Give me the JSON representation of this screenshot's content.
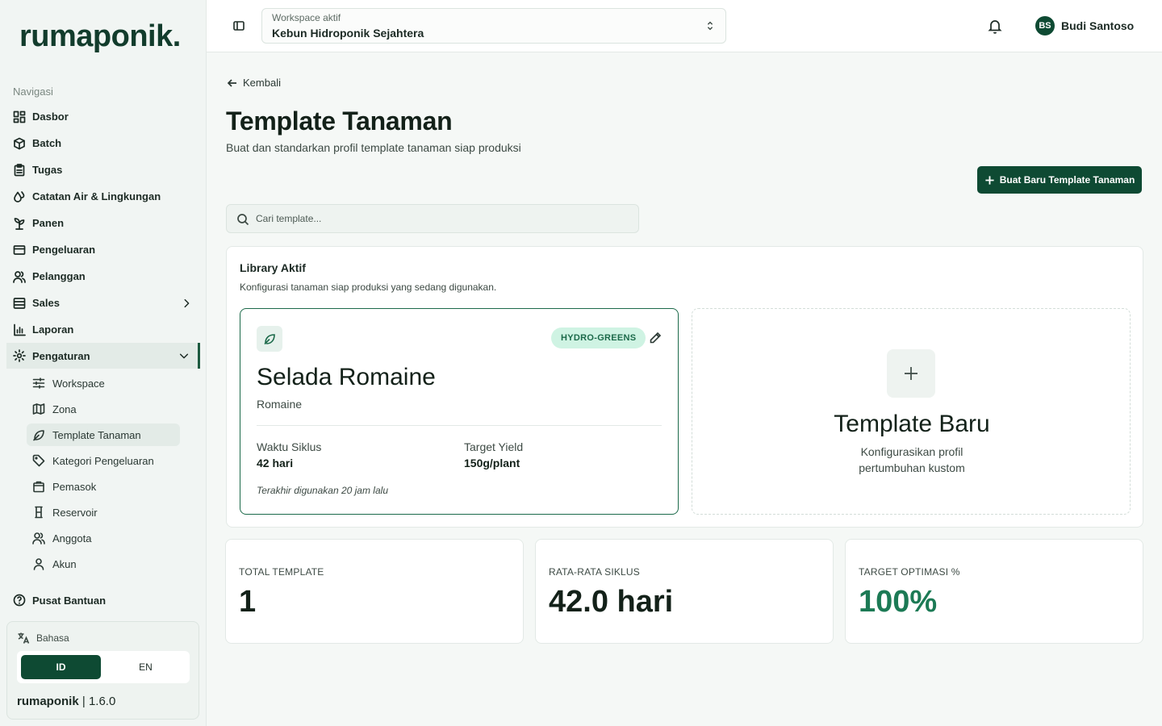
{
  "app": {
    "logo": "rumaponik."
  },
  "sidebar": {
    "nav_title": "Navigasi",
    "items": [
      {
        "label": "Dasbor",
        "icon": "grid-icon"
      },
      {
        "label": "Batch",
        "icon": "package-icon"
      },
      {
        "label": "Tugas",
        "icon": "clipboard-icon"
      },
      {
        "label": "Catatan Air & Lingkungan",
        "icon": "droplet-icon"
      },
      {
        "label": "Panen",
        "icon": "sprout-icon"
      },
      {
        "label": "Pengeluaran",
        "icon": "wallet-icon"
      },
      {
        "label": "Pelanggan",
        "icon": "users-icon"
      },
      {
        "label": "Sales",
        "icon": "receipt-icon"
      },
      {
        "label": "Laporan",
        "icon": "bar-chart-icon"
      },
      {
        "label": "Pengaturan",
        "icon": "gear-icon"
      }
    ],
    "sub_items": [
      {
        "label": "Workspace",
        "icon": "sliders-icon"
      },
      {
        "label": "Zona",
        "icon": "map-icon"
      },
      {
        "label": "Template Tanaman",
        "icon": "leaf-icon"
      },
      {
        "label": "Kategori Pengeluaran",
        "icon": "tag-icon"
      },
      {
        "label": "Pemasok",
        "icon": "shopping-bag-icon"
      },
      {
        "label": "Reservoir",
        "icon": "tank-icon"
      },
      {
        "label": "Anggota",
        "icon": "users-icon"
      },
      {
        "label": "Akun",
        "icon": "user-icon"
      }
    ],
    "help": "Pusat Bantuan",
    "language": {
      "label": "Bahasa",
      "options": [
        "ID",
        "EN"
      ],
      "selected": "ID"
    },
    "version_brand": "rumaponik",
    "version_sep": "|",
    "version_number": "1.6.0"
  },
  "topbar": {
    "workspace_label": "Workspace aktif",
    "workspace_value": "Kebun Hidroponik Sejahtera",
    "user_initials": "BS",
    "user_name": "Budi Santoso"
  },
  "main": {
    "back_label": "Kembali",
    "title": "Template Tanaman",
    "subtitle": "Buat dan standarkan profil template tanaman siap produksi",
    "new_button": "Buat Baru Template Tanaman",
    "search_placeholder": "Cari template...",
    "library": {
      "title": "Library Aktif",
      "subtitle": "Konfigurasi tanaman siap produksi yang sedang digunakan.",
      "templates": [
        {
          "badge": "HYDRO-GREENS",
          "name": "Selada Romaine",
          "variety": "Romaine",
          "cycle_label": "Waktu Siklus",
          "cycle_value": "42 hari",
          "yield_label": "Target Yield",
          "yield_value": "150g/plant",
          "last_used": "Terakhir digunakan 20 jam lalu"
        }
      ],
      "new_card": {
        "title": "Template Baru",
        "desc": "Konfigurasikan profil pertumbuhan kustom"
      }
    },
    "kpis": [
      {
        "label": "TOTAL TEMPLATE",
        "value": "1"
      },
      {
        "label": "RATA-RATA SIKLUS",
        "value": "42.0 hari"
      },
      {
        "label": "TARGET OPTIMASI %",
        "value": "100%"
      }
    ]
  },
  "colors": {
    "primary": "#0e4a33",
    "accent": "#1c7a55",
    "badge_bg": "#cff3e3"
  }
}
